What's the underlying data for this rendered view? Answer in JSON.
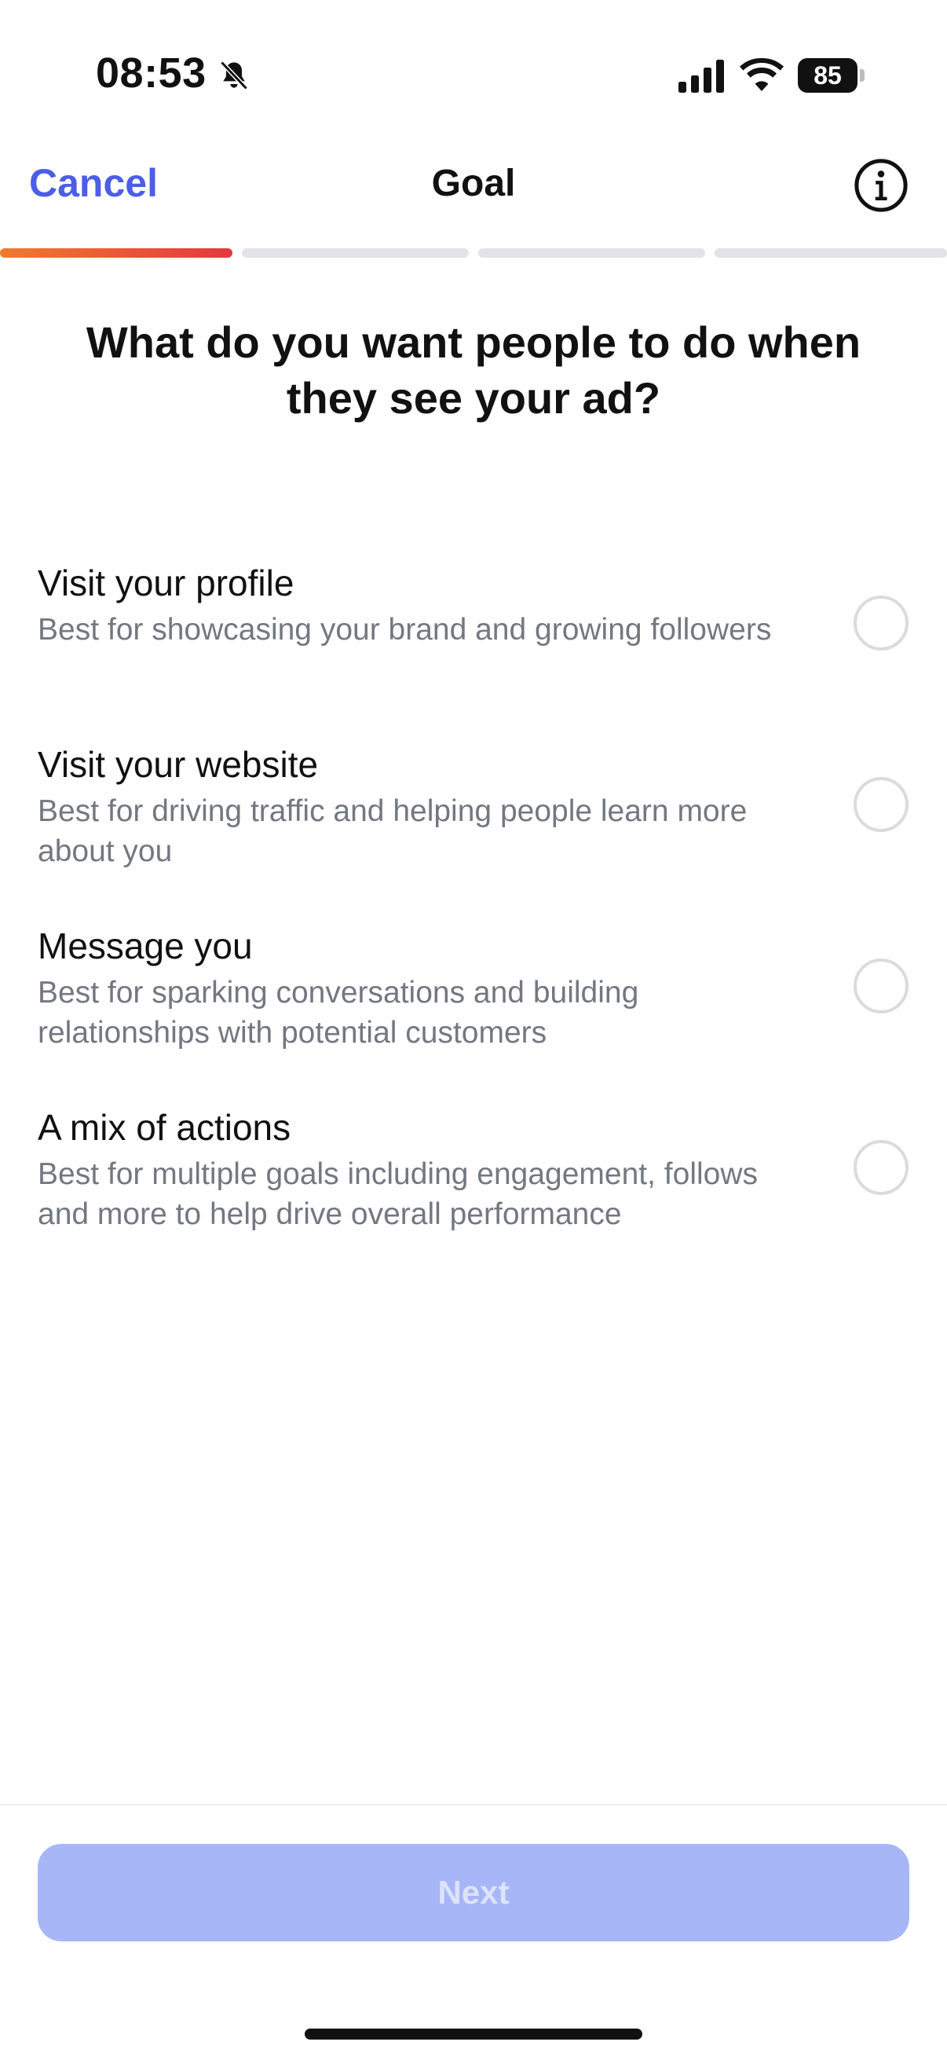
{
  "status_bar": {
    "time": "08:53",
    "battery": "85",
    "icons": [
      "bell-slash-icon",
      "cellular-signal-icon",
      "wifi-icon",
      "battery-icon"
    ]
  },
  "nav": {
    "cancel_label": "Cancel",
    "title": "Goal",
    "info_icon": "info-icon"
  },
  "progress": {
    "total_steps": 4,
    "current_step": 1,
    "active_colors": [
      "#f07a2e",
      "#e4383f"
    ],
    "inactive_color": "#e1e3e6"
  },
  "question": "What do you want people to do when they see your ad?",
  "options": [
    {
      "title": "Visit your profile",
      "description": "Best for showcasing your brand and growing followers",
      "selected": false
    },
    {
      "title": "Visit your website",
      "description": "Best for driving traffic and helping people learn more about you",
      "selected": false
    },
    {
      "title": "Message you",
      "description": "Best for sparking conversations and building relationships with potential customers",
      "selected": false
    },
    {
      "title": "A mix of actions",
      "description": "Best for multiple goals including engagement, follows and more to help drive overall performance",
      "selected": false
    }
  ],
  "footer": {
    "next_label": "Next",
    "next_disabled": true
  },
  "colors": {
    "accent": "#4c5ee6",
    "button_disabled": "#a7b6f6",
    "secondary_text": "#737880"
  }
}
